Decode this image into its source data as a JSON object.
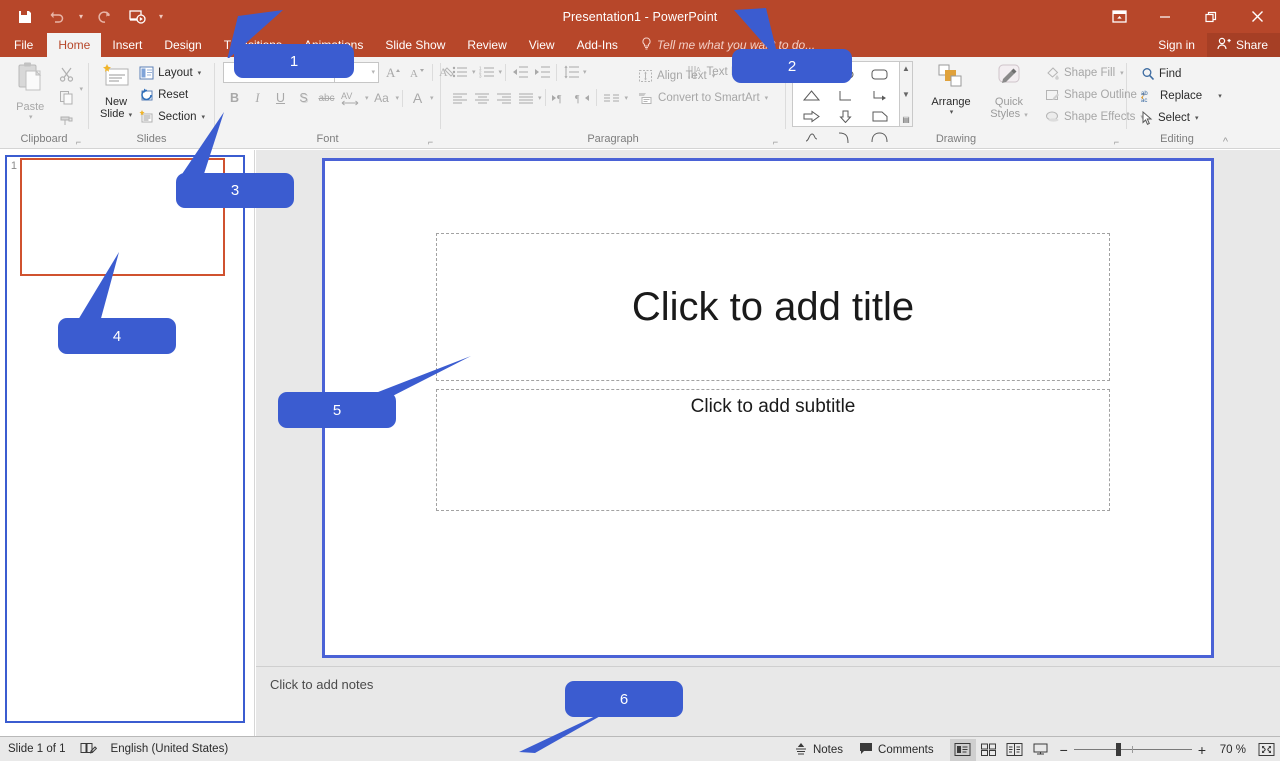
{
  "window": {
    "title": "Presentation1 - PowerPoint",
    "accent_color": "#b7472a",
    "callout_color": "#3b5cd0",
    "controls": [
      {
        "name": "ribbon-display-options",
        "label": "Ribbon Display Options"
      },
      {
        "name": "minimize",
        "label": "Minimize"
      },
      {
        "name": "restore",
        "label": "Restore Down"
      },
      {
        "name": "close",
        "label": "Close"
      }
    ]
  },
  "quick_access": {
    "items": [
      {
        "name": "save-icon",
        "label": "Save"
      },
      {
        "name": "undo-icon",
        "label": "Undo"
      },
      {
        "name": "redo-icon",
        "label": "Redo"
      },
      {
        "name": "start-from-beginning-icon",
        "label": "Start From Beginning"
      },
      {
        "name": "customize-quick-access-toolbar-icon",
        "label": "Customize Quick Access Toolbar"
      }
    ]
  },
  "tabs": [
    {
      "label": "File",
      "active": false
    },
    {
      "label": "Home",
      "active": true
    },
    {
      "label": "Insert",
      "active": false
    },
    {
      "label": "Design",
      "active": false
    },
    {
      "label": "Transitions",
      "active": false
    },
    {
      "label": "Animations",
      "active": false
    },
    {
      "label": "Slide Show",
      "active": false
    },
    {
      "label": "Review",
      "active": false
    },
    {
      "label": "View",
      "active": false
    },
    {
      "label": "Add-Ins",
      "active": false
    }
  ],
  "tell_me": {
    "placeholder": "Tell me what you want to do..."
  },
  "account": {
    "sign_in": "Sign in",
    "share": "Share"
  },
  "ribbon": {
    "clipboard": {
      "label": "Clipboard",
      "paste": "Paste",
      "cut": "Cut",
      "copy": "Copy",
      "format_painter": "Format Painter"
    },
    "slides": {
      "label": "Slides",
      "new_slide_line1": "New",
      "new_slide_line2": "Slide",
      "layout": "Layout",
      "reset": "Reset",
      "section": "Section"
    },
    "font": {
      "label": "Font",
      "font_name_value": "",
      "font_size_value": "",
      "increase_font_size": "A",
      "decrease_font_size": "A",
      "clear_formatting": "Clear All Formatting",
      "bold": "B",
      "italic": "I",
      "underline": "U",
      "shadow": "S",
      "strikethrough": "abc",
      "character_spacing": "AV",
      "change_case": "Aa",
      "font_color": "A"
    },
    "paragraph": {
      "label": "Paragraph",
      "text_direction": "Text Direction",
      "align_text": "Align Text",
      "convert_to_smartart": "Convert to SmartArt"
    },
    "drawing": {
      "label": "Drawing",
      "arrange": "Arrange",
      "quick_styles_line1": "Quick",
      "quick_styles_line2": "Styles",
      "shape_fill": "Shape Fill",
      "shape_outline": "Shape Outline",
      "shape_effects": "Shape Effects"
    },
    "editing": {
      "label": "Editing",
      "find": "Find",
      "replace": "Replace",
      "select": "Select"
    },
    "collapse": "Collapse the Ribbon"
  },
  "slide_panel": {
    "thumbnails": [
      {
        "number": "1"
      }
    ]
  },
  "slide": {
    "title_placeholder": "Click to add title",
    "subtitle_placeholder": "Click to add subtitle"
  },
  "notes": {
    "placeholder": "Click to add notes"
  },
  "status_bar": {
    "slide_count": "Slide 1 of 1",
    "spelling_icon": "spell-check-icon",
    "language": "English (United States)",
    "notes_button": "Notes",
    "comments_button": "Comments",
    "views": [
      {
        "name": "normal-view",
        "label": "Normal",
        "active": true
      },
      {
        "name": "slide-sorter-view",
        "label": "Slide Sorter",
        "active": false
      },
      {
        "name": "reading-view",
        "label": "Reading View",
        "active": false
      },
      {
        "name": "slide-show-view",
        "label": "Slide Show",
        "active": false
      }
    ],
    "zoom_out": "−",
    "zoom_in": "+",
    "zoom_value": "70 %",
    "fit_to_window": "Fit slide to current window"
  },
  "callouts": [
    {
      "number": "1"
    },
    {
      "number": "2"
    },
    {
      "number": "3"
    },
    {
      "number": "4"
    },
    {
      "number": "5"
    },
    {
      "number": "6"
    }
  ]
}
